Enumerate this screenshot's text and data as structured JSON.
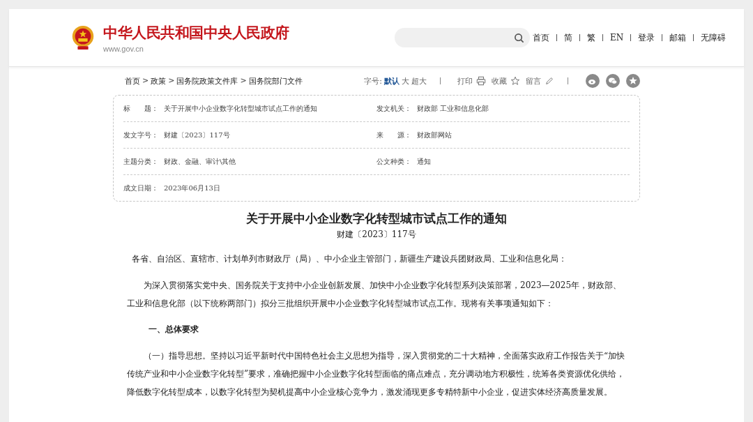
{
  "header": {
    "site_title": "中华人民共和国中央人民政府",
    "site_url": "www.gov.cn",
    "nav": [
      "首页",
      "简",
      "繁",
      "EN",
      "登录",
      "邮箱",
      "无障碍"
    ]
  },
  "breadcrumb": [
    "首页",
    "政策",
    "国务院政策文件库",
    "国务院部门文件"
  ],
  "breadcrumb_separator": ">",
  "toolbar": {
    "font_size_label": "字号:",
    "font_sizes": [
      {
        "label": "默认",
        "selected": true
      },
      {
        "label": "大",
        "selected": false
      },
      {
        "label": "超大",
        "selected": false
      }
    ],
    "actions": [
      {
        "label": "打印",
        "kind": "print"
      },
      {
        "label": "收藏",
        "kind": "star"
      },
      {
        "label": "留言",
        "kind": "pencil"
      }
    ],
    "share": [
      {
        "kind": "weibo"
      },
      {
        "kind": "wechat"
      },
      {
        "kind": "favorite"
      }
    ]
  },
  "info": [
    [
      {
        "label": "标　　题：",
        "value": "关于开展中小企业数字化转型城市试点工作的通知"
      },
      {
        "label": "发文机关：",
        "value": "财政部  工业和信息化部"
      }
    ],
    [
      {
        "label": "发文字号：",
        "value": "财建〔2023〕117号"
      },
      {
        "label": "来　　源：",
        "value": "财政部网站"
      }
    ],
    [
      {
        "label": "主题分类：",
        "value": "财政、金融、审计\\其他"
      },
      {
        "label": "公文种类：",
        "value": "通知"
      }
    ],
    [
      {
        "label": "成文日期：",
        "value": "2023年06月13日"
      }
    ]
  ],
  "article": {
    "title": "关于开展中小企业数字化转型城市试点工作的通知",
    "doc_number": "财建〔2023〕117号",
    "blocks": [
      {
        "kind": "salutation",
        "text": "各省、自治区、直辖市、计划单列市财政厅（局）、中小企业主管部门，新疆生产建设兵团财政局、工业和信息化局："
      },
      {
        "kind": "paragraph",
        "text": "为深入贯彻落实党中央、国务院关于支持中小企业创新发展、加快中小企业数字化转型系列决策部署，2023—2025年，财政部、工业和信息化部（以下统称两部门）拟分三批组织开展中小企业数字化转型城市试点工作。现将有关事项通知如下："
      },
      {
        "kind": "heading",
        "text": "一、总体要求"
      },
      {
        "kind": "paragraph",
        "text": "（一）指导思想。坚持以习近平新时代中国特色社会主义思想为指导，深入贯彻党的二十大精神，全面落实政府工作报告关于“加快传统产业和中小企业数字化转型”要求，准确把握中小企业数字化转型面临的痛点难点，充分调动地方积极性，统筹各类资源优化供给，降低数字化转型成本，以数字化转型为契机提高中小企业核心竞争力，激发涌现更多专精特新中小企业，促进实体经济高质量发展。"
      }
    ]
  }
}
